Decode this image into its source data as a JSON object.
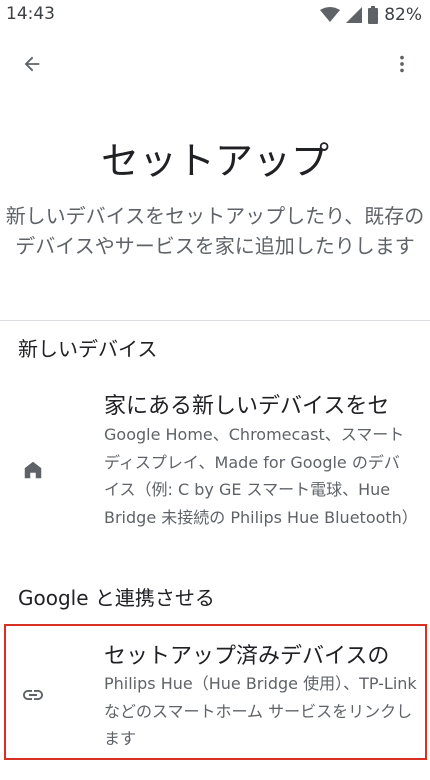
{
  "status_bar": {
    "time": "14:43",
    "battery": "82%",
    "icons": [
      "wifi-icon",
      "signal-icon",
      "battery-icon"
    ]
  },
  "app_bar": {
    "back_icon": "arrow-back-icon",
    "more_icon": "more-vert-icon"
  },
  "page": {
    "title": "セットアップ",
    "subtitle": "新しいデバイスをセットアップしたり、既存のデバイスやサービスを家に追加したりします"
  },
  "sections": {
    "new_devices": {
      "header": "新しいデバイス",
      "item": {
        "icon": "home-icon",
        "title": "家にある新しいデバイスをセ",
        "description": "Google Home、Chromecast、スマートディスプレイ、Made for Google のデバイス（例: C by GE スマート電球、Hue Bridge 未接続の Philips Hue Bluetooth）"
      }
    },
    "works_with_google": {
      "header": "Google と連携させる",
      "item": {
        "icon": "link-icon",
        "title": "セットアップ済みデバイスの",
        "description": "Philips Hue（Hue Bridge 使用）、TP-Link などのスマートホーム サービスをリンクします"
      }
    }
  },
  "colors": {
    "text_primary": "#202124",
    "text_secondary": "#5f6368",
    "highlight_border": "#d93025",
    "divider": "#dadce0"
  }
}
